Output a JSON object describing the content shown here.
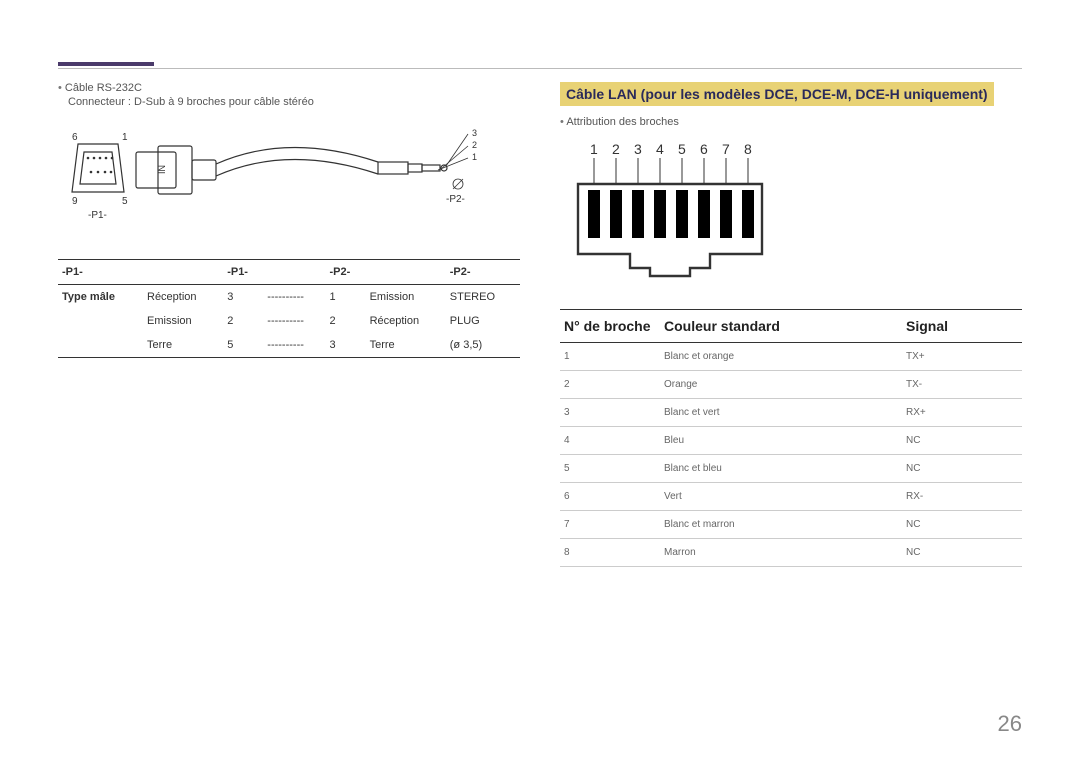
{
  "left": {
    "bullet1": "Câble RS-232C",
    "sub1": "Connecteur : D-Sub à 9 broches pour câble stéréo",
    "diagram": {
      "p1_label": "-P1-",
      "p2_label": "-P2-",
      "pins_left": [
        "6",
        "1",
        "9",
        "5"
      ],
      "pins_right": [
        "3",
        "2",
        "1"
      ],
      "in_label": "IN"
    },
    "table": {
      "headers": [
        "-P1-",
        "",
        "-P1-",
        "",
        "-P2-",
        "",
        "-P2-"
      ],
      "rows": [
        [
          "Type mâle",
          "Réception",
          "3",
          "----------",
          "1",
          "Emission",
          "STEREO"
        ],
        [
          "",
          "Emission",
          "2",
          "----------",
          "2",
          "Réception",
          "PLUG"
        ],
        [
          "",
          "Terre",
          "5",
          "----------",
          "3",
          "Terre",
          "(ø 3,5)"
        ]
      ]
    }
  },
  "right": {
    "heading": "Câble LAN (pour les modèles DCE, DCE-M, DCE-H uniquement)",
    "bullet1": "Attribution des broches",
    "rj45_numbers": [
      "1",
      "2",
      "3",
      "4",
      "5",
      "6",
      "7",
      "8"
    ],
    "color_head": {
      "pin": "N° de broche",
      "color": "Couleur standard",
      "signal": "Signal"
    },
    "color_rows": [
      {
        "pin": "1",
        "color": "Blanc et orange",
        "signal": "TX+"
      },
      {
        "pin": "2",
        "color": "Orange",
        "signal": "TX-"
      },
      {
        "pin": "3",
        "color": "Blanc et vert",
        "signal": "RX+"
      },
      {
        "pin": "4",
        "color": "Bleu",
        "signal": "NC"
      },
      {
        "pin": "5",
        "color": "Blanc et bleu",
        "signal": "NC"
      },
      {
        "pin": "6",
        "color": "Vert",
        "signal": "RX-"
      },
      {
        "pin": "7",
        "color": "Blanc et marron",
        "signal": "NC"
      },
      {
        "pin": "8",
        "color": "Marron",
        "signal": "NC"
      }
    ]
  },
  "page_number": "26"
}
